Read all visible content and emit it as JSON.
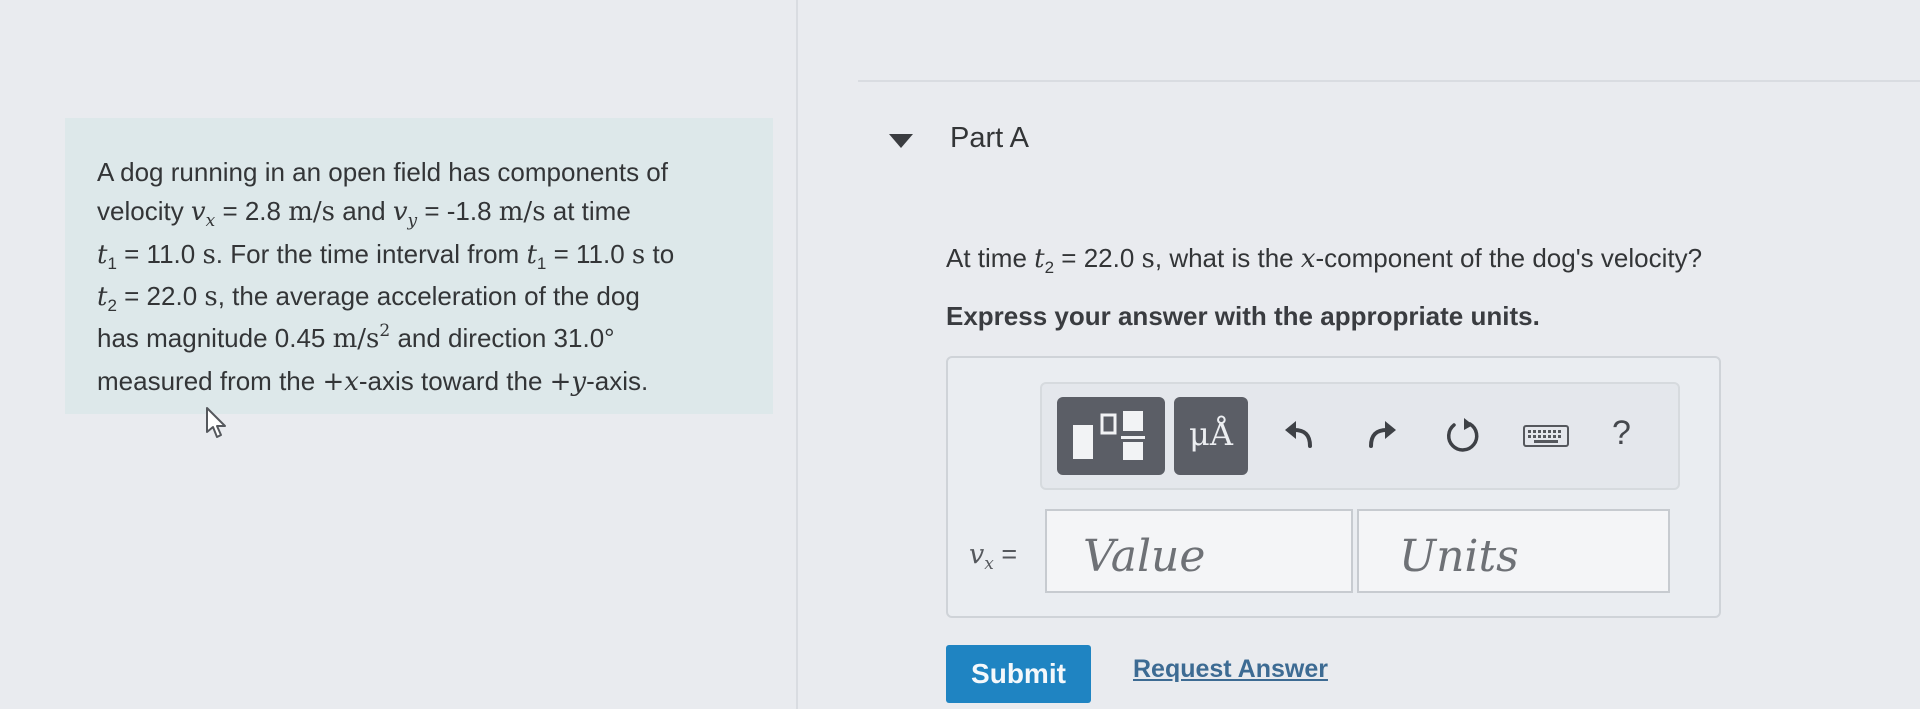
{
  "problem": {
    "line1": "A dog running in an open field has components of",
    "line2": {
      "t1": "velocity ",
      "vx_sym": "v",
      "vx_sub": "x",
      "vx_val": " = 2.8 ",
      "vx_unit": "m/s",
      "t2": " and ",
      "vy_sym": "v",
      "vy_sub": "y",
      "vy_val": " = -1.8 ",
      "vy_unit": "m/s",
      "t3": " at time"
    },
    "line3": {
      "t1_sym": "t",
      "t1_sub": "1",
      "t1_val": " = 11.0 ",
      "t1_unit": "s",
      "text": ". For the time interval from ",
      "t1b_sym": "t",
      "t1b_sub": "1",
      "t1b_val": " = 11.0 ",
      "t1b_unit": "s",
      "end": " to"
    },
    "line4": {
      "t2_sym": "t",
      "t2_sub": "2",
      "t2_val": " = 22.0 ",
      "t2_unit": "s",
      "text": ", the average acceleration of the dog"
    },
    "line5": {
      "text": "has magnitude 0.45 ",
      "unit": "m/s",
      "exp": "2",
      "text2": " and direction 31.0°"
    },
    "line6": {
      "text": "measured from the ",
      "plus_x": "+x",
      "mid": "-axis toward the ",
      "plus_y": "+y",
      "end": "-axis."
    }
  },
  "part": {
    "title": "Part A",
    "question": {
      "pre": "At time ",
      "sym": "t",
      "sub": "2",
      "val": " = 22.0 ",
      "unit": "s",
      "mid": ", what is the ",
      "x": "x",
      "post": "-component of the dog's velocity?"
    },
    "instructions": "Express your answer with the appropriate units."
  },
  "toolbar": {
    "units_label": "μÅ",
    "help_label": "?",
    "icons": [
      "templates-icon",
      "units-icon",
      "undo-icon",
      "redo-icon",
      "reset-icon",
      "keyboard-icon",
      "help-icon"
    ]
  },
  "answer": {
    "var_sym": "v",
    "var_sub": "x",
    "var_eq": " =",
    "value_placeholder": "Value",
    "units_placeholder": "Units"
  },
  "actions": {
    "submit": "Submit",
    "request": "Request Answer"
  },
  "colors": {
    "background": "#e9ebef",
    "problem_box": "#dde8ea",
    "submit": "#1f84c2",
    "link": "#3d6b93",
    "tool_dark": "#5b5e66"
  }
}
